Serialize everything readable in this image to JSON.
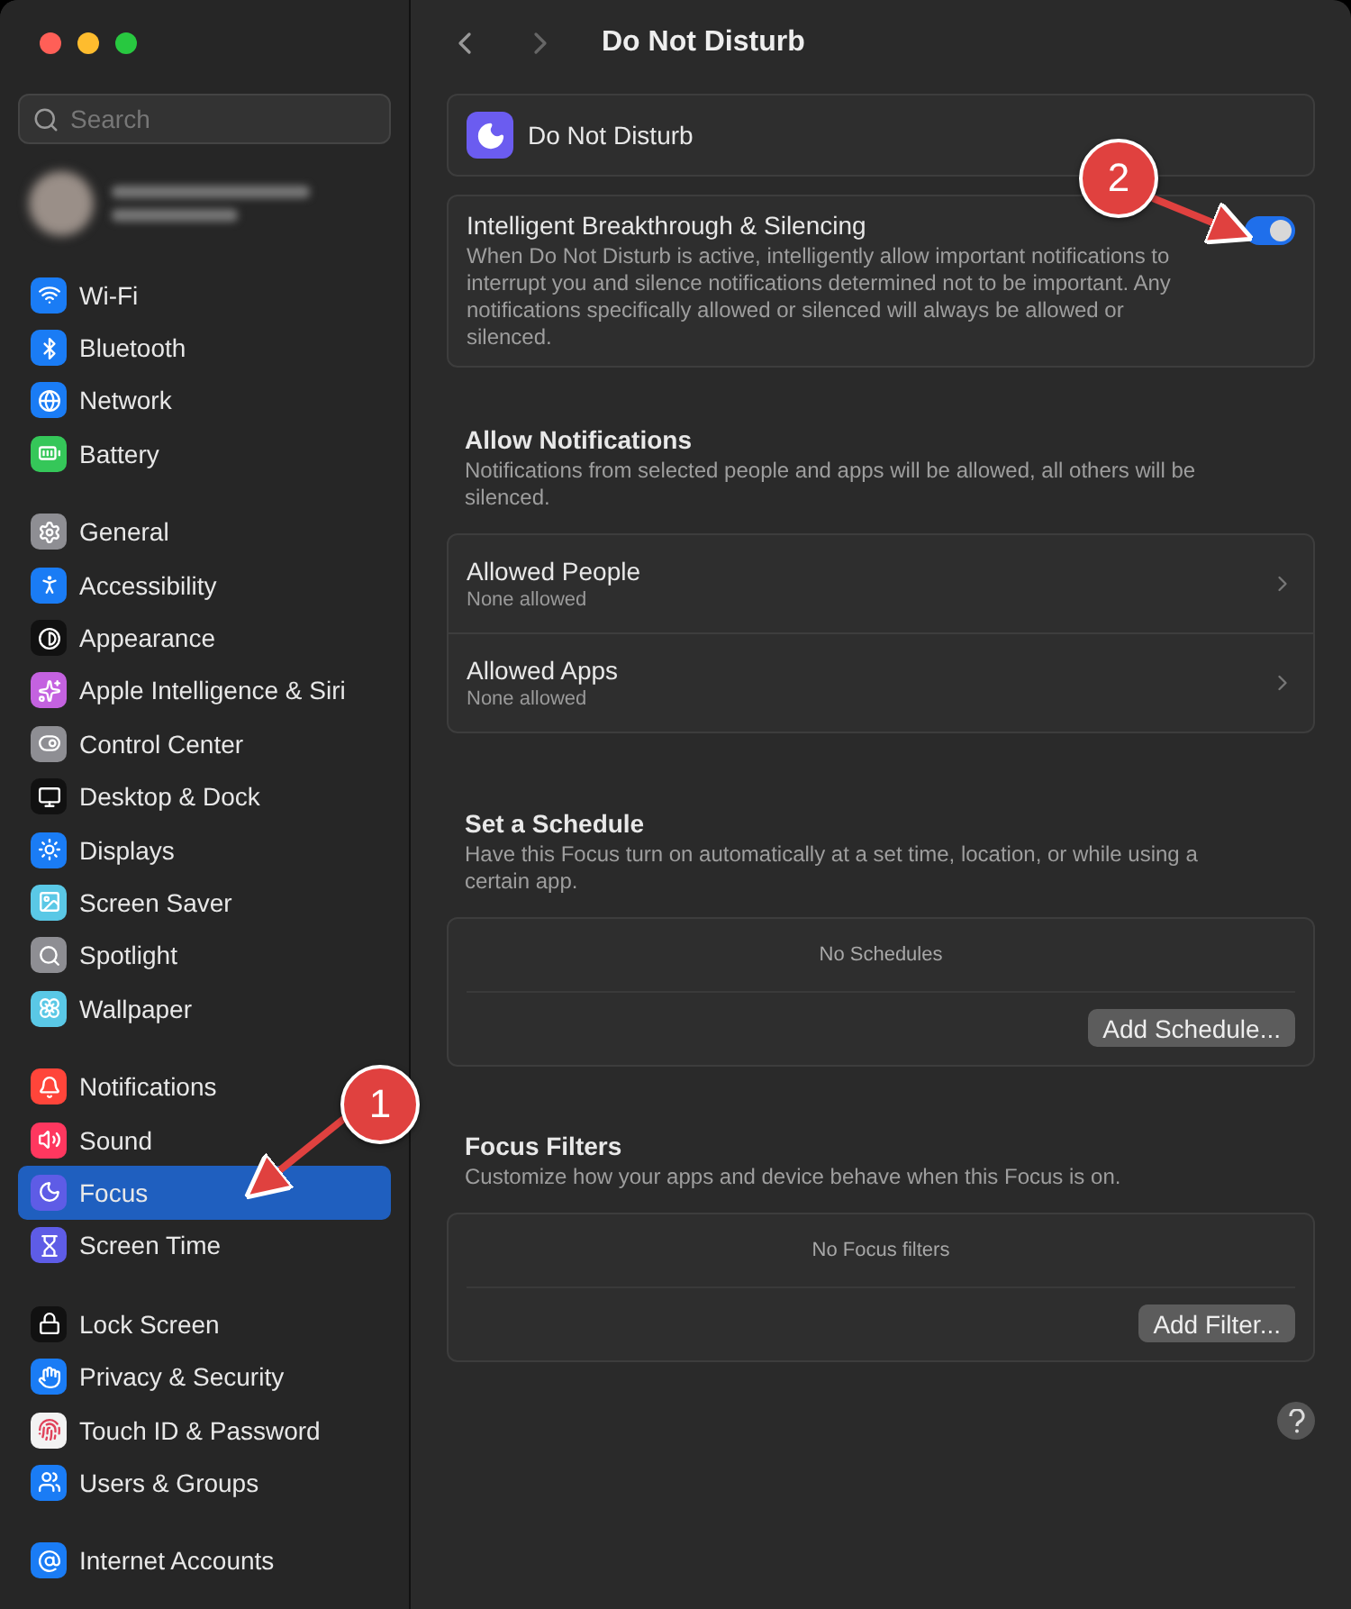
{
  "sidebar": {
    "search": {
      "placeholder": "Search"
    },
    "groups": [
      {
        "items": [
          {
            "label": "Wi-Fi",
            "color": "#1a7cf5",
            "selected": false
          },
          {
            "label": "Bluetooth",
            "color": "#1a7cf5",
            "selected": false
          },
          {
            "label": "Network",
            "color": "#1a7cf5",
            "selected": false
          },
          {
            "label": "Battery",
            "color": "#35c759",
            "selected": false
          }
        ]
      },
      {
        "items": [
          {
            "label": "General",
            "color": "#8e8e93",
            "selected": false
          },
          {
            "label": "Accessibility",
            "color": "#1a7cf5",
            "selected": false
          },
          {
            "label": "Appearance",
            "color": "#111111",
            "selected": false
          },
          {
            "label": "Apple Intelligence & Siri",
            "color": "#c462e0",
            "selected": false
          },
          {
            "label": "Control Center",
            "color": "#8e8e93",
            "selected": false
          },
          {
            "label": "Desktop & Dock",
            "color": "#111111",
            "selected": false
          },
          {
            "label": "Displays",
            "color": "#1a7cf5",
            "selected": false
          },
          {
            "label": "Screen Saver",
            "color": "#5ac8e6",
            "selected": false
          },
          {
            "label": "Spotlight",
            "color": "#8e8e93",
            "selected": false
          },
          {
            "label": "Wallpaper",
            "color": "#5ac8e6",
            "selected": false
          }
        ]
      },
      {
        "items": [
          {
            "label": "Notifications",
            "color": "#ff453a",
            "selected": false
          },
          {
            "label": "Sound",
            "color": "#ff375f",
            "selected": false
          },
          {
            "label": "Focus",
            "color": "#5e5ce6",
            "selected": true
          },
          {
            "label": "Screen Time",
            "color": "#5e5ce6",
            "selected": false
          }
        ]
      },
      {
        "items": [
          {
            "label": "Lock Screen",
            "color": "#111111",
            "selected": false
          },
          {
            "label": "Privacy & Security",
            "color": "#1a7cf5",
            "selected": false
          },
          {
            "label": "Touch ID & Password",
            "color": "#f2f2f2",
            "selected": false
          },
          {
            "label": "Users & Groups",
            "color": "#1a7cf5",
            "selected": false
          }
        ]
      },
      {
        "items": [
          {
            "label": "Internet Accounts",
            "color": "#1a7cf5",
            "selected": false
          }
        ]
      }
    ]
  },
  "main": {
    "title": "Do Not Disturb",
    "focus_header": {
      "label": "Do Not Disturb"
    },
    "breakthrough": {
      "title": "Intelligent Breakthrough & Silencing",
      "description": "When Do Not Disturb is active, intelligently allow important notifications to interrupt you and silence notifications determined not to be important. Any notifications specifically allowed or silenced will always be allowed or silenced.",
      "on": true
    },
    "allow_notifications": {
      "title": "Allow Notifications",
      "description": "Notifications from selected people and apps will be allowed, all others will be silenced.",
      "rows": [
        {
          "title": "Allowed People",
          "subtitle": "None allowed"
        },
        {
          "title": "Allowed Apps",
          "subtitle": "None allowed"
        }
      ]
    },
    "sections": [
      {
        "title": "Set a Schedule",
        "description": "Have this Focus turn on automatically at a set time, location, or while using a certain app.",
        "empty_text": "No Schedules",
        "button": "Add Schedule..."
      },
      {
        "title": "Focus Filters",
        "description": "Customize how your apps and device behave when this Focus is on.",
        "empty_text": "No Focus filters",
        "button": "Add Filter..."
      }
    ]
  },
  "callouts": [
    {
      "number": "1"
    },
    {
      "number": "2"
    }
  ]
}
